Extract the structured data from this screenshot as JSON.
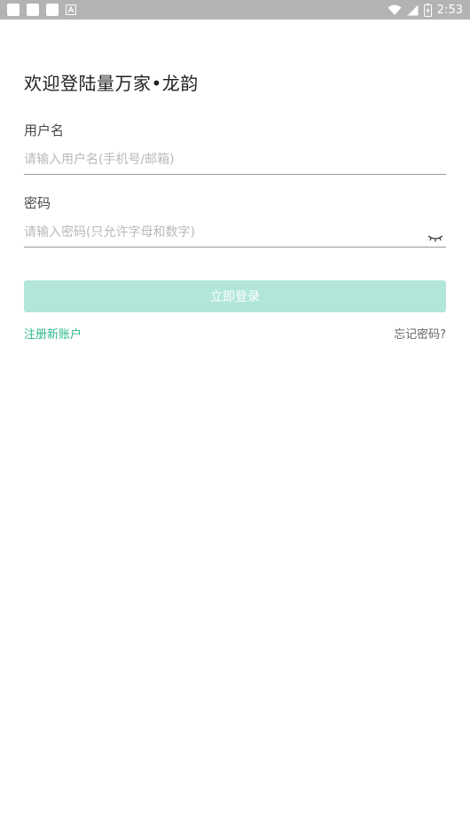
{
  "status_bar": {
    "time": "2:53",
    "icons": [
      "notification-square-icon",
      "notification-square-icon",
      "notification-square-icon",
      "notification-a-icon",
      "wifi-icon",
      "signal-icon",
      "battery-icon"
    ]
  },
  "login": {
    "title": "欢迎登陆量万家•龙韵",
    "username_label": "用户名",
    "username_placeholder": "请输入用户名(手机号/邮箱)",
    "username_value": "",
    "password_label": "密码",
    "password_placeholder": "请输入密码(只允许字母和数字)",
    "password_value": "",
    "submit_label": "立即登录",
    "register_label": "注册新账户",
    "forgot_label": "忘记密码?"
  },
  "colors": {
    "accent": "#2bb88e",
    "button_disabled": "#b2e6db",
    "status_bar": "#b3b3b3"
  }
}
